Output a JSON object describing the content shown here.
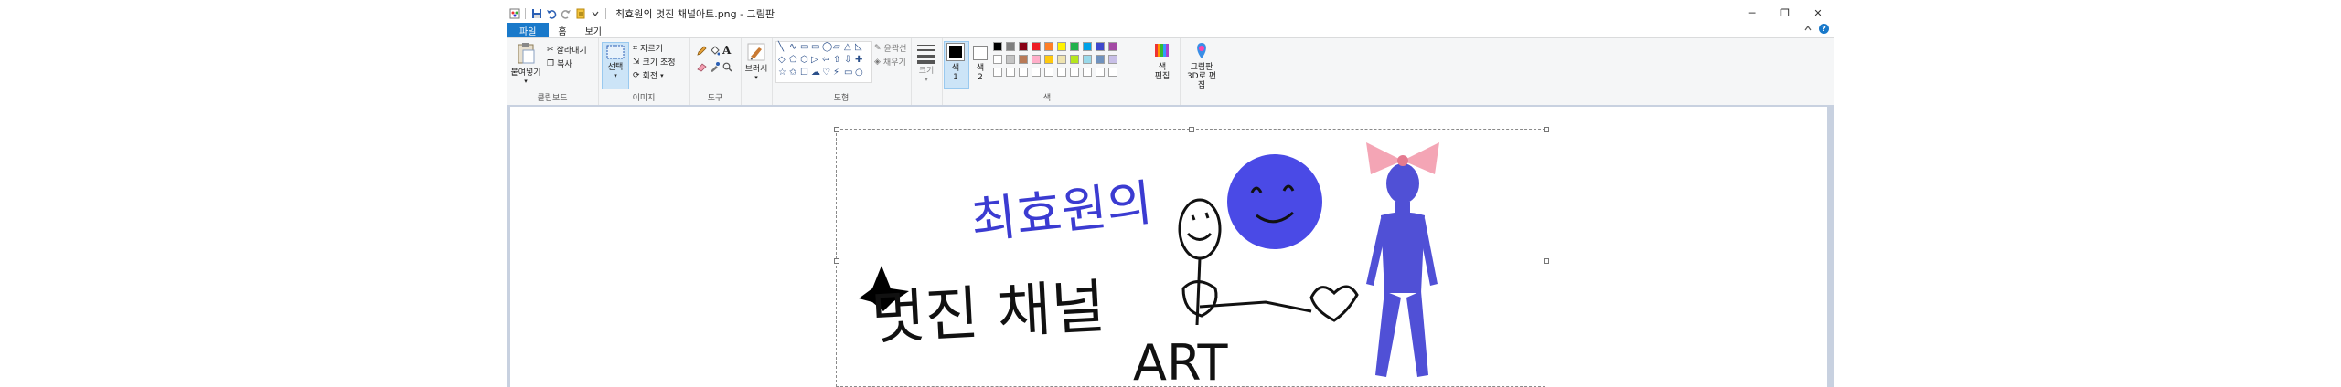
{
  "window": {
    "title": "최효원의 멋진 채널아트.png - 그림판",
    "controls": {
      "minimize": "─",
      "maximize": "❐",
      "close": "✕"
    }
  },
  "tabs": {
    "file": "파일",
    "home": "홈",
    "view": "보기"
  },
  "ribbon": {
    "clipboard": {
      "label": "클립보드",
      "paste": "붙여넣기",
      "cut": "잘라내기",
      "copy": "복사"
    },
    "image": {
      "label": "이미지",
      "select": "선택",
      "crop": "자르기",
      "resize": "크기 조정",
      "rotate": "회전"
    },
    "tools": {
      "label": "도구"
    },
    "brushes": {
      "label": "브러시"
    },
    "shapes": {
      "label": "도형",
      "outline": "윤곽선",
      "fill": "채우기"
    },
    "size": {
      "label": "크기"
    },
    "colors": {
      "label": "색",
      "color1": "색\n1",
      "color2": "색\n2",
      "edit_colors": "색\n편집",
      "palette_row1": [
        "#000000",
        "#7f7f7f",
        "#880015",
        "#ed1c24",
        "#ff7f27",
        "#fff200",
        "#22b14c",
        "#00a2e8",
        "#3f48cc",
        "#a349a4"
      ],
      "palette_row2": [
        "#ffffff",
        "#c3c3c3",
        "#b97a57",
        "#ffaec9",
        "#ffc90e",
        "#efe4b0",
        "#b5e61d",
        "#99d9ea",
        "#7092be",
        "#c8bfe7"
      ]
    },
    "paint3d": {
      "label": "그림판 3D로 편집"
    }
  },
  "canvas": {
    "art_title": "최효원의",
    "art_subtitle": "멋진 채널",
    "art_text": "ART"
  }
}
